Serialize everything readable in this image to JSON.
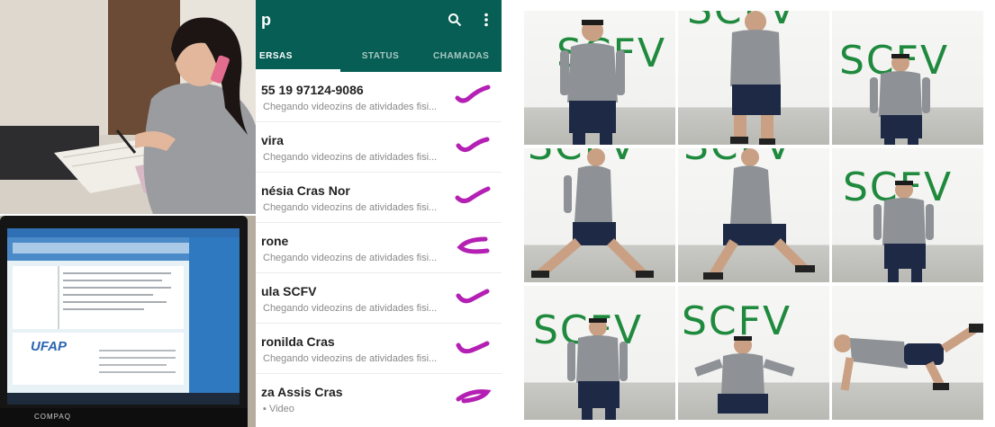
{
  "whatsapp": {
    "title": "p",
    "tabs": [
      {
        "label": "ERSAS",
        "active": true
      },
      {
        "label": "STATUS",
        "active": false
      },
      {
        "label": "CHAMADAS",
        "active": false
      }
    ],
    "chats": [
      {
        "name": "55 19 97124-9086",
        "preview": "Chegando videozins de atividades fisi..."
      },
      {
        "name": "vira",
        "preview": "Chegando videozins de atividades fisi..."
      },
      {
        "name": "nésia Cras Nor",
        "preview": "Chegando videozins de atividades fisi..."
      },
      {
        "name": "rone",
        "preview": "Chegando videozins de atividades fisi..."
      },
      {
        "name": "ula SCFV",
        "preview": "Chegando videozins de atividades fisi..."
      },
      {
        "name": "ronilda Cras",
        "preview": "Chegando videozins de atividades fisi..."
      },
      {
        "name": "za Assis Cras",
        "preview": "▪ Video"
      }
    ],
    "colors": {
      "header": "#075e54",
      "tick": "#b41fb4"
    }
  },
  "laptop": {
    "logo": "UFAP",
    "brand": "COMPAQ"
  },
  "grid": {
    "cells": [
      {
        "watermark": "SCFV",
        "pose": "stand-front"
      },
      {
        "watermark": "SCFV",
        "pose": "walk-back"
      },
      {
        "watermark": "SCFV",
        "pose": "stand-front"
      },
      {
        "watermark": "SCFV",
        "pose": "lunge-side"
      },
      {
        "watermark": "SCFV",
        "pose": "lunge-side"
      },
      {
        "watermark": "SCFV",
        "pose": "stand-front"
      },
      {
        "watermark": "SCFV",
        "pose": "stand-front"
      },
      {
        "watermark": "SCFV",
        "pose": "arms-out"
      },
      {
        "watermark": "",
        "pose": "plank-leg"
      }
    ],
    "colors": {
      "watermark": "#1f8a3e",
      "shirt": "#8e9296",
      "shorts": "#1e2a45"
    }
  }
}
